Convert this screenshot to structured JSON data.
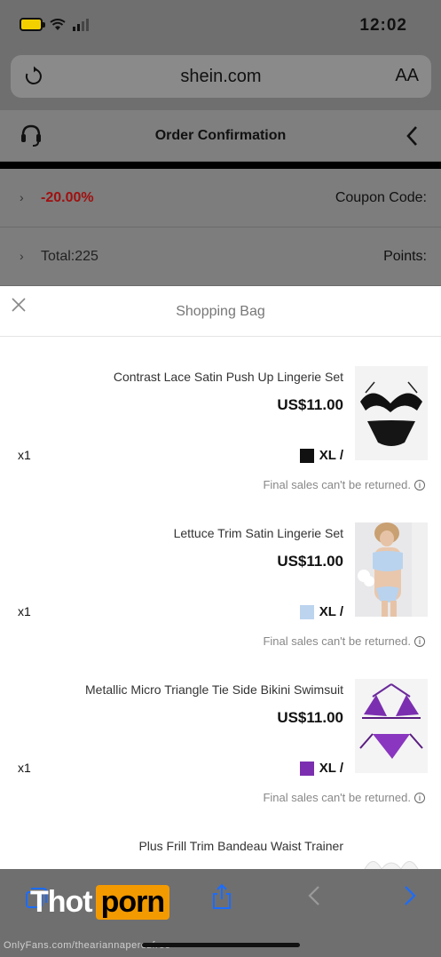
{
  "status_bar": {
    "time": "12:02"
  },
  "browser": {
    "domain": "shein.com",
    "text_size_label": "AA"
  },
  "order": {
    "title": "Order Confirmation",
    "coupon_label": "Coupon Code:",
    "coupon_value": "-20.00%",
    "points_label": "Points:",
    "points_value": "Total:225"
  },
  "bag": {
    "title": "Shopping Bag",
    "items": [
      {
        "name": "Contrast Lace Satin Push Up Lingerie Set",
        "price": "US$11.00",
        "size": "XL /",
        "swatch": "#111111",
        "qty": "x1",
        "note": "Final sales can't be returned."
      },
      {
        "name": "Lettuce Trim Satin Lingerie Set",
        "price": "US$11.00",
        "size": "XL /",
        "swatch": "#bcd4ee",
        "qty": "x1",
        "note": "Final sales can't be returned."
      },
      {
        "name": "Metallic Micro Triangle Tie Side Bikini Swimsuit",
        "price": "US$11.00",
        "size": "XL /",
        "swatch": "#7b2fb0",
        "qty": "x1",
        "note": "Final sales can't be returned."
      },
      {
        "name": "Plus Frill Trim Bandeau Waist Trainer",
        "price": "",
        "size": "",
        "swatch": "#ffffff",
        "qty": "",
        "note": ""
      }
    ]
  },
  "watermark": {
    "part1": "Thot",
    "part2": "porn",
    "handle": "OnlyFans.com/theariannaperezfree"
  }
}
